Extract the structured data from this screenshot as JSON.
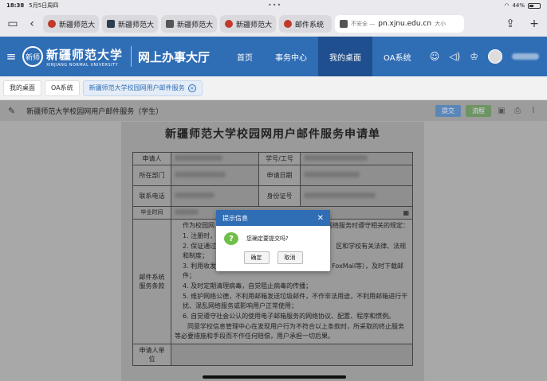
{
  "status_bar": {
    "time": "18:38",
    "date": "5月5日周四",
    "battery": "44%"
  },
  "browser": {
    "tabs": [
      {
        "label": "新疆师范大",
        "icon": "site-icon"
      },
      {
        "label": "新疆师范大",
        "icon": "pen-icon"
      },
      {
        "label": "新疆师范大",
        "icon": "page-icon"
      },
      {
        "label": "新疆师范大",
        "icon": "site-icon"
      },
      {
        "label": "邮件系统",
        "icon": "site-icon"
      }
    ],
    "url_tab": {
      "security": "不安全 —",
      "host": "pn.xjnu.edu.cn",
      "suffix": "大小"
    }
  },
  "portal": {
    "logo_badge": "新师",
    "logo_cn": "新疆师范大学",
    "logo_en": "XINJIANG NORMAL UNIVERSITY",
    "title": "网上办事大厅",
    "nav": [
      "首页",
      "事务中心",
      "我的桌面",
      "OA系统"
    ],
    "active_nav": 2
  },
  "page_tabs": [
    "我的桌面",
    "OA系统",
    "新疆师范大学校园网用户邮件服务"
  ],
  "form_toolbar": {
    "title": "新疆师范大学校园网用户邮件服务（学生）",
    "submit": "提交",
    "flow": "流程"
  },
  "document": {
    "title": "新疆师范大学校园网用户邮件服务申请单",
    "labels": {
      "applicant": "申请人",
      "student_id": "学号/工号",
      "department": "所在部门",
      "apply_date": "申请日期",
      "phone": "联系电话",
      "id_number": "身份证号",
      "grad_date": "毕业时间",
      "terms": "邮件系统服务条款",
      "unit": "申请人单位"
    },
    "terms_intro_a": "作为校园网",
    "terms_intro_b": "网络服务时遵守相关的规定：",
    "terms": [
      "1. 注册时，",
      "2. 保证通过",
      "区和学校有关法律、法规和制度；",
      "3. 利用收发邮件的客户端软件（Outlook Express、FoxMail等），及时下载邮件；",
      "4. 及时定期清理病毒，自觉阻止病毒的传播；",
      "5. 维护网络公德，不利用邮箱发送垃圾邮件，不作非法用途，不利用邮箱进行干扰、混乱网络服务或影响用户正常使用；",
      "6. 自觉遵守社会公认的使用电子邮箱服务的网络协议、配置、程序和惯例。"
    ],
    "terms_footer": "同意学校信息管理中心在发现用户行为不符合以上条款时，所采取的终止服务等必要措施和手段而不作任何赔偿，用户承担一切后果。"
  },
  "modal": {
    "title": "提示信息",
    "message": "您确定要提交吗?",
    "confirm": "确定",
    "cancel": "取消"
  }
}
